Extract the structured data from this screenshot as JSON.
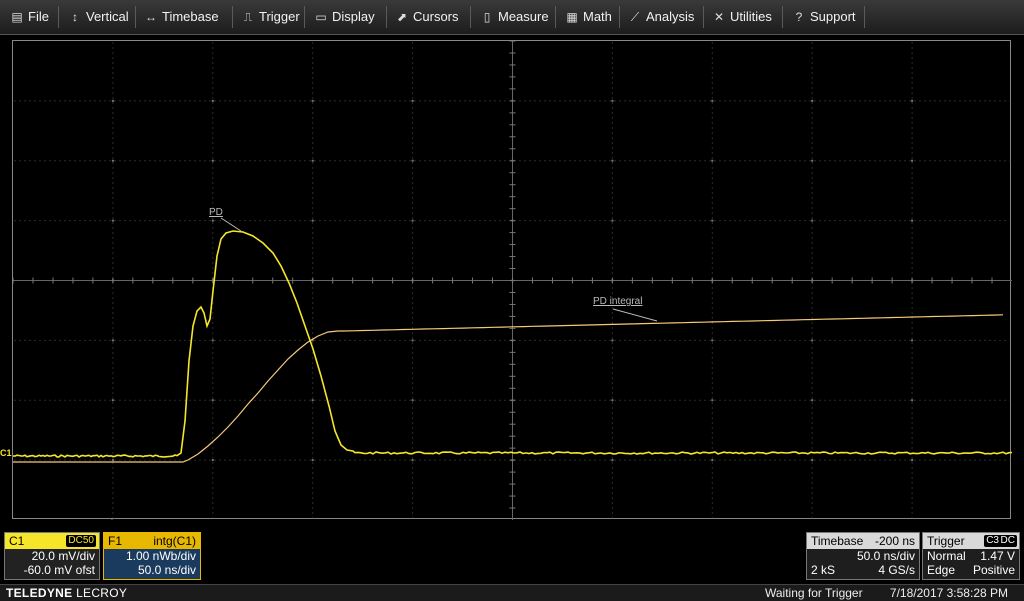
{
  "menu": [
    {
      "label": "File",
      "icon": "file-icon",
      "glyph": "▤"
    },
    {
      "label": "Vertical",
      "icon": "vertical-arrows-icon",
      "glyph": "↕"
    },
    {
      "label": "Timebase",
      "icon": "horizontal-arrows-icon",
      "glyph": "↔"
    },
    {
      "label": "Trigger",
      "icon": "trigger-icon",
      "glyph": "⎍"
    },
    {
      "label": "Display",
      "icon": "display-icon",
      "glyph": "▭"
    },
    {
      "label": "Cursors",
      "icon": "cursors-icon",
      "glyph": "⬈"
    },
    {
      "label": "Measure",
      "icon": "measure-icon",
      "glyph": "▯"
    },
    {
      "label": "Math",
      "icon": "math-icon",
      "glyph": "▦"
    },
    {
      "label": "Analysis",
      "icon": "analysis-icon",
      "glyph": "⟋"
    },
    {
      "label": "Utilities",
      "icon": "utilities-icon",
      "glyph": "✕"
    },
    {
      "label": "Support",
      "icon": "support-icon",
      "glyph": "?"
    }
  ],
  "traces": {
    "c1_label": "PD",
    "f1_label": "PD integral",
    "c1_marker": "C1",
    "c1_color": "#f5e62a",
    "f1_color": "#f6c97a"
  },
  "c1": {
    "name": "C1",
    "coupling": "DC50",
    "vdiv": "20.0 mV/div",
    "offset": "-60.0 mV ofst",
    "color": "#f5e62a"
  },
  "f1": {
    "name": "F1",
    "func": "intg(C1)",
    "vdiv": "1.00 nWb/div",
    "tdiv": "50.0 ns/div",
    "color": "#e8b800"
  },
  "timebase": {
    "label": "Timebase",
    "delay": "-200 ns",
    "tdiv": "50.0 ns/div",
    "samples": "2 kS",
    "rate": "4 GS/s"
  },
  "trigger": {
    "label": "Trigger",
    "source": "C3",
    "coupling": "DC",
    "mode": "Normal",
    "level": "1.47 V",
    "type": "Edge",
    "slope": "Positive"
  },
  "status": {
    "brand_bold": "TELEDYNE",
    "brand_light": "LECROY",
    "message": "Waiting for Trigger",
    "datetime": "7/18/2017 3:58:28 PM"
  }
}
